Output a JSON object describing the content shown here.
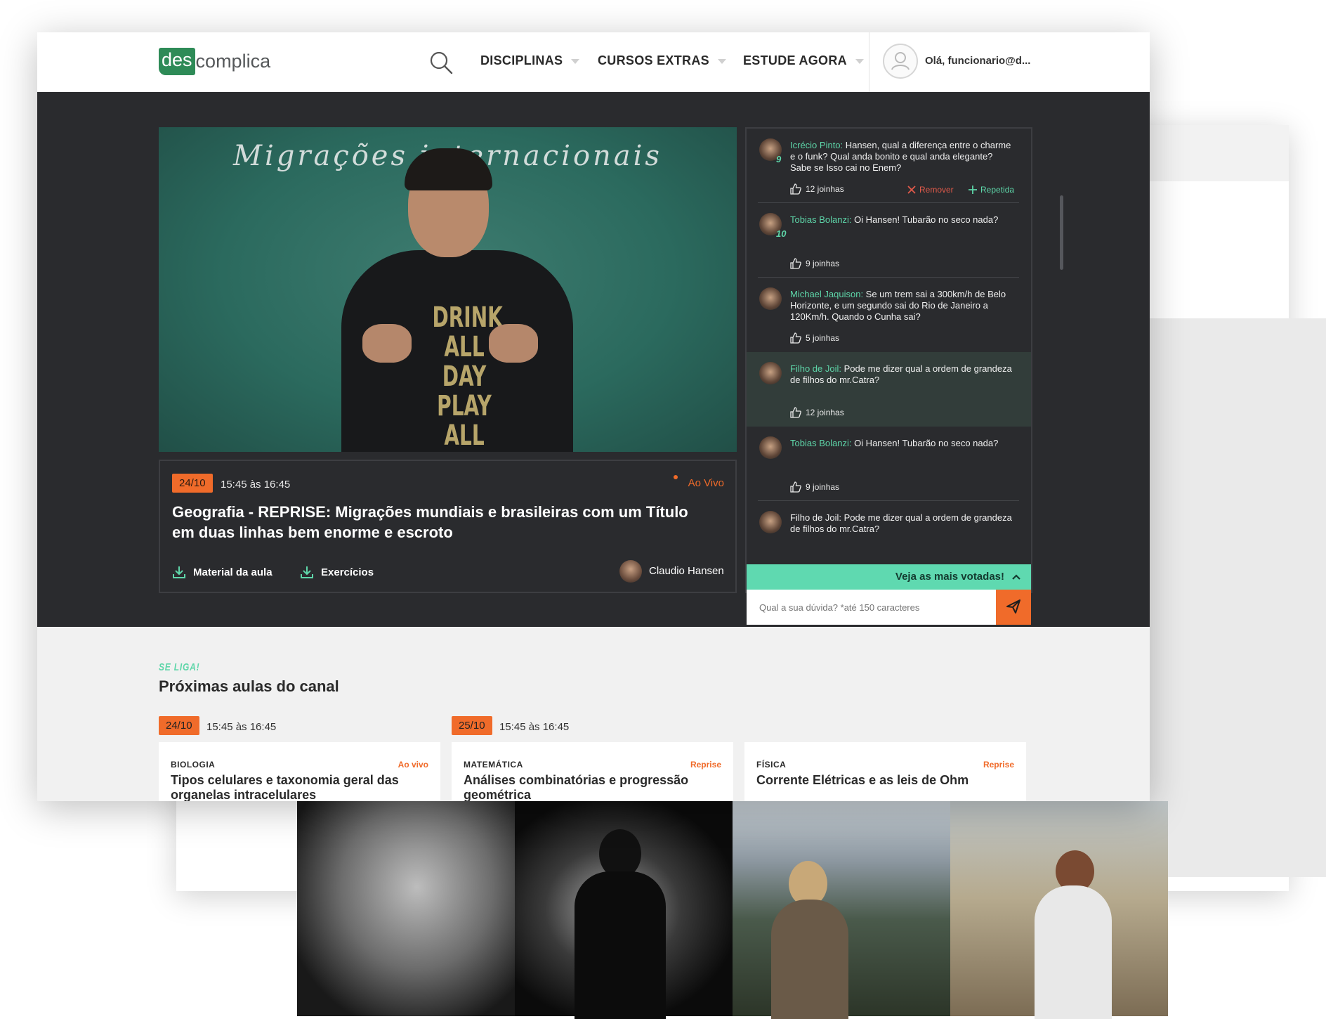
{
  "header": {
    "logo_prefix": "des",
    "logo_suffix": "complica",
    "nav": [
      {
        "label": "DISCIPLINAS"
      },
      {
        "label": "CURSOS EXTRAS"
      },
      {
        "label": "ESTUDE AGORA"
      }
    ],
    "greeting": "Olá, funcionario@d..."
  },
  "video": {
    "board_text": "Migrações internacionais",
    "shirt_text": "DRINK ALL DAY PLAY ALL NIGHT"
  },
  "lesson": {
    "date": "24/10",
    "time": "15:45 às 16:45",
    "status": "Ao Vivo",
    "title": "Geografia - REPRISE: Migrações mundiais e brasileiras com um Título em duas linhas bem enorme e escroto",
    "material_label": "Material da aula",
    "exercises_label": "Exercícios",
    "author": "Claudio Hansen"
  },
  "chat": {
    "messages": [
      {
        "name": "Icrécio Pinto:",
        "text": " Hansen, qual a diferença entre o charme e o funk? Qual anda bonito e qual anda elegante? Sabe se Isso cai no Enem?",
        "likes": "12 joinhas",
        "rank": "9",
        "remove": "Remover",
        "repeat": "Repetida"
      },
      {
        "name": "Tobias Bolanzi:",
        "text": " Oi Hansen! Tubarão no seco nada?",
        "likes": "9 joinhas",
        "rank": "10"
      },
      {
        "name": "Michael Jaquison:",
        "text": " Se um trem sai a 300km/h de Belo Horizonte, e um segundo sai do Rio de Janeiro a 120Km/h. Quando o Cunha sai?",
        "likes": "5 joinhas"
      },
      {
        "name": "Filho de Joil:",
        "text": " Pode me dizer qual a ordem de grandeza de filhos do mr.Catra?",
        "likes": "12 joinhas"
      },
      {
        "name": "Tobias Bolanzi:",
        "text": " Oi Hansen! Tubarão no seco nada?",
        "likes": "9 joinhas"
      },
      {
        "name": "",
        "text": "Filho de Joil: Pode me dizer qual a ordem de grandeza de filhos do mr.Catra?",
        "likes": ""
      }
    ],
    "most_voted_label": "Veja as mais votadas!",
    "input_placeholder": "Qual a sua dúvida? *até 150 caracteres"
  },
  "upcoming": {
    "kicker": "SE LIGA!",
    "title": "Próximas aulas do canal",
    "groups": [
      {
        "date": "24/10",
        "time": "15:45 às 16:45"
      },
      {
        "date": "25/10",
        "time": "15:45 às 16:45"
      }
    ],
    "cards": [
      {
        "subject": "BIOLOGIA",
        "tag": "Ao vivo",
        "title": "Tipos celulares e taxonomia geral das organelas intracelulares"
      },
      {
        "subject": "MATEMÁTICA",
        "tag": "Reprise",
        "title": "Análises combinatórias e progressão geométrica"
      },
      {
        "subject": "FÍSICA",
        "tag": "Reprise",
        "title": "Corrente Elétricas e as leis de Ohm"
      }
    ]
  },
  "colors": {
    "accent_orange": "#f06b2a",
    "accent_green": "#5ed6a9",
    "dark_bg": "#2a2b2e",
    "logo_green": "#2e8b57"
  }
}
